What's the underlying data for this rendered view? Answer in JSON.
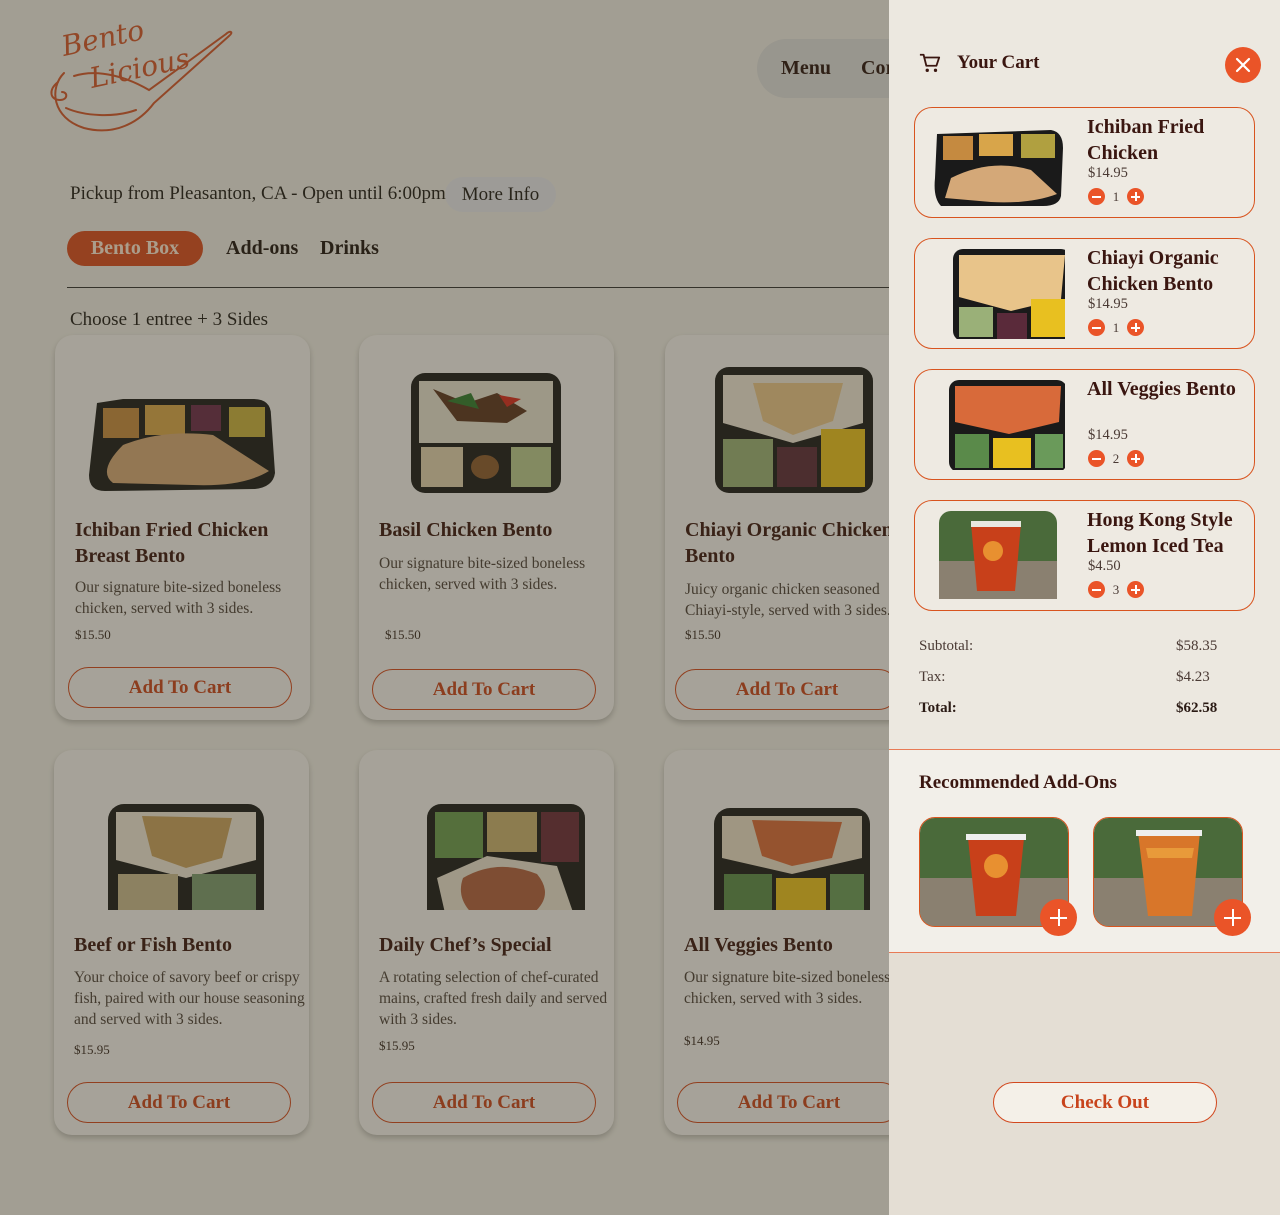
{
  "header": {
    "logo_text_line1": "Bento",
    "logo_text_line2": "Licious",
    "nav": [
      "Menu",
      "Cor"
    ]
  },
  "store": {
    "pickup": "Pickup from Pleasanton, CA - Open until 6:00pm",
    "more_info": "More Info"
  },
  "tabs": [
    "Bento Box",
    "Add-ons",
    "Drinks"
  ],
  "section_note": "Choose 1 entree + 3 Sides",
  "products": [
    {
      "name_lines": [
        "Ichiban Fried Chicken",
        "Breast Bento"
      ],
      "desc": "Our signature bite-sized boneless chicken, served with 3 sides.",
      "price": "$15.50",
      "button": "Add To Cart"
    },
    {
      "name_lines": [
        "Basil Chicken Bento"
      ],
      "desc": "Our signature bite-sized boneless chicken, served with 3 sides.",
      "price": "$15.50",
      "button": "Add To Cart"
    },
    {
      "name_lines": [
        "Chiayi Organic Chicken",
        "Bento"
      ],
      "desc": "Juicy organic chicken seasoned Chiayi-style, served with 3 sides.",
      "price": "$15.50",
      "button": "Add To Cart"
    },
    {
      "name_lines": [
        "Beef or Fish Bento"
      ],
      "desc": "Your choice of savory beef or crispy fish, paired with our house seasoning and served with 3 sides.",
      "price": "$15.95",
      "button": "Add To Cart"
    },
    {
      "name_lines": [
        "Daily Chef’s Special"
      ],
      "desc": "A rotating selection of chef-curated mains, crafted fresh daily and served with 3 sides.",
      "price": "$15.95",
      "button": "Add To Cart"
    },
    {
      "name_lines": [
        "All Veggies Bento"
      ],
      "desc": "Our signature bite-sized boneless chicken, served with 3 sides.",
      "price": "$14.95",
      "button": "Add To Cart"
    }
  ],
  "cart": {
    "title": "Your Cart",
    "items": [
      {
        "name": "Ichiban Fried Chicken",
        "price": "$14.95",
        "qty": "1"
      },
      {
        "name": "Chiayi Organic Chicken Bento",
        "price": "$14.95",
        "qty": "1"
      },
      {
        "name": "All Veggies Bento",
        "price": "$14.95",
        "qty": "2"
      },
      {
        "name": "Hong Kong Style Lemon Iced Tea",
        "price": "$4.50",
        "qty": "3"
      }
    ],
    "subtotal_label": "Subtotal:",
    "subtotal": "$58.35",
    "tax_label": "Tax:",
    "tax": "$4.23",
    "total_label": "Total:",
    "total": "$62.58",
    "recommended_title": "Recommended Add-Ons",
    "checkout": "Check Out"
  },
  "colors": {
    "accent": "#ea5428",
    "overlay": "#3a3422"
  },
  "icons": [
    "cart-icon",
    "close-icon",
    "minus-icon",
    "plus-icon"
  ]
}
